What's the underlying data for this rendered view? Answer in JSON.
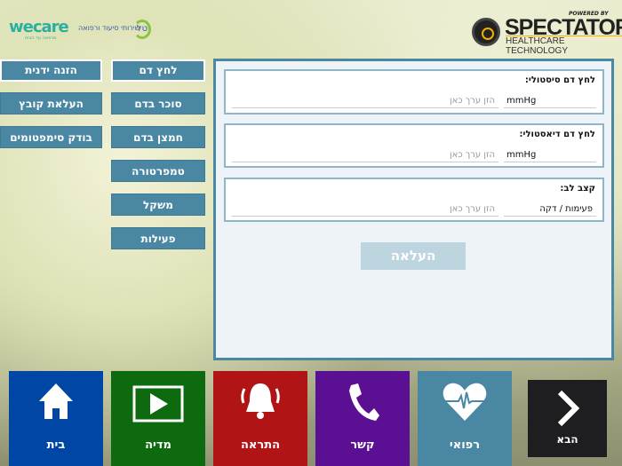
{
  "header": {
    "wecare_logo": "wecare",
    "wecare_hebrew": "שירותי סיעוד ורפואה",
    "wecare_tagline": "מרפאה עד הבית",
    "tal_logo": "טל",
    "powered_by": "POWERED BY",
    "brand": "SPECTATOR",
    "brand_sub": "HEALTHCARE TECHNOLOGY"
  },
  "measure_menu": [
    "לחץ דם",
    "סוכר בדם",
    "חמצן בדם",
    "טמפרטורה",
    "משקל",
    "פעילות"
  ],
  "input_menu": [
    "הזנה ידנית",
    "העלאת קובץ",
    "בודק סימפטומים"
  ],
  "form": {
    "fields": [
      {
        "label": "לחץ דם סיסטולי:",
        "unit": "mmHg",
        "placeholder": "הזן ערך כאן",
        "value": ""
      },
      {
        "label": "לחץ דם דיאסטולי:",
        "unit": "mmHg",
        "placeholder": "הזן ערך כאן",
        "value": ""
      },
      {
        "label": "קצב לב:",
        "unit": "פעימות / דקה",
        "placeholder": "הזן ערך כאן",
        "value": ""
      }
    ],
    "submit": "העלאה"
  },
  "bottom_nav": [
    {
      "label": "בית",
      "icon": "home-icon",
      "color": "#0047a5"
    },
    {
      "label": "מדיה",
      "icon": "media-play-icon",
      "color": "#0e6a0e"
    },
    {
      "label": "התראה",
      "icon": "bell-icon",
      "color": "#b01414"
    },
    {
      "label": "קשר",
      "icon": "phone-icon",
      "color": "#5b0f92"
    },
    {
      "label": "רפואי",
      "icon": "heart-pulse-icon",
      "color": "#4a87a3"
    }
  ],
  "next": "הבא"
}
